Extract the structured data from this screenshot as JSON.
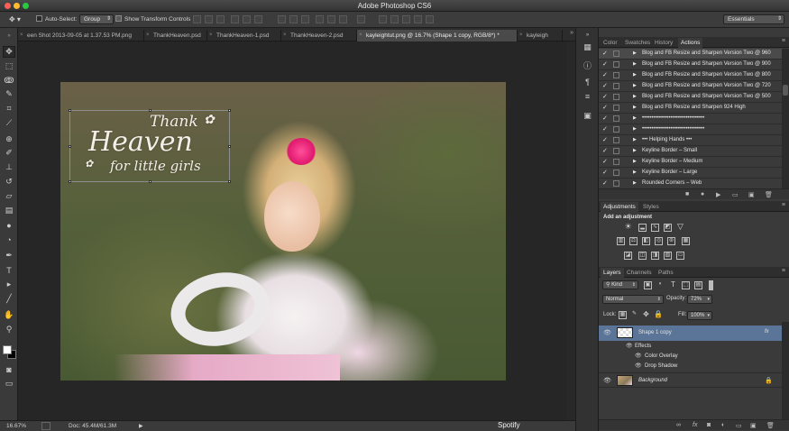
{
  "app": {
    "window_title": "Adobe Photoshop CS6"
  },
  "options_bar": {
    "auto_select_label": "Auto-Select:",
    "auto_select_value": "Group",
    "show_transform_label": "Show Transform Controls",
    "workspace_value": "Essentials"
  },
  "document_tabs": [
    {
      "label": "een Shot 2013-09-05 at 1.37.53 PM.png",
      "active": false
    },
    {
      "label": "ThankHeaven.psd",
      "active": false
    },
    {
      "label": "ThankHeaven-1.psd",
      "active": false
    },
    {
      "label": "ThankHeaven-2.psd",
      "active": false
    },
    {
      "label": "kayleightut.png @ 16.7% (Shape 1 copy, RGB/8*) *",
      "active": true
    },
    {
      "label": "kayleigh",
      "active": false
    }
  ],
  "tabs_overflow": "»",
  "canvas_overlay": {
    "line1": "Thank",
    "line2": "Heaven",
    "line3": "for little girls"
  },
  "status_bar": {
    "zoom": "16.67%",
    "doc_size": "Doc: 45.4M/61.3M"
  },
  "dock_label": "Spotify",
  "actions_panel": {
    "tabs": [
      "Color",
      "Swatches",
      "History",
      "Actions"
    ],
    "active_tab": "Actions",
    "rows": [
      {
        "label": "Blog and FB Resize and Sharpen Version Two @ 960",
        "checked": true
      },
      {
        "label": "Blog and FB Resize and Sharpen Version Two @ 900",
        "checked": true
      },
      {
        "label": "Blog and FB Resize and Sharpen Version Two @ 800",
        "checked": true
      },
      {
        "label": "Blog and FB Resize and Sharpen Version Two @ 720",
        "checked": true
      },
      {
        "label": "Blog and FB Resize and Sharpen Version Two @ 500",
        "checked": true
      },
      {
        "label": "Blog and FB Resize and Sharpen 924 High",
        "checked": true
      },
      {
        "label": "•••••••••••••••••••••••••••••••••",
        "checked": true
      },
      {
        "label": "•••••••••••••••••••••••••••••••••",
        "checked": true
      },
      {
        "label": "•••  Helping Hands  •••",
        "checked": true
      },
      {
        "label": "Keyline Border – Small",
        "checked": true
      },
      {
        "label": "Keyline Border – Medium",
        "checked": true
      },
      {
        "label": "Keyline Border – Large",
        "checked": true
      },
      {
        "label": "Rounded Corners – Web",
        "checked": true
      }
    ]
  },
  "adjustments_panel": {
    "tabs": [
      "Adjustments",
      "Styles"
    ],
    "active_tab": "Adjustments",
    "heading": "Add an adjustment"
  },
  "layers_panel": {
    "tabs": [
      "Layers",
      "Channels",
      "Paths"
    ],
    "active_tab": "Layers",
    "filter_value": "Kind",
    "blend_mode": "Normal",
    "opacity_label": "Opacity:",
    "opacity_value": "72%",
    "lock_label": "Lock:",
    "fill_label": "Fill:",
    "fill_value": "100%",
    "layers": [
      {
        "name": "Shape 1 copy",
        "selected": true,
        "fx": "fx"
      },
      {
        "name": "Effects",
        "sub": true
      },
      {
        "name": "Color Overlay",
        "sub": true
      },
      {
        "name": "Drop Shadow",
        "sub": true
      },
      {
        "name": "Background",
        "selected": false
      }
    ]
  },
  "colors": {
    "accent_selected": "#5b7599",
    "panel_bg": "#3a3a3a",
    "close_button": "#ff5f56",
    "minimize_button": "#ffbd2e",
    "zoom_button": "#27c93f"
  }
}
